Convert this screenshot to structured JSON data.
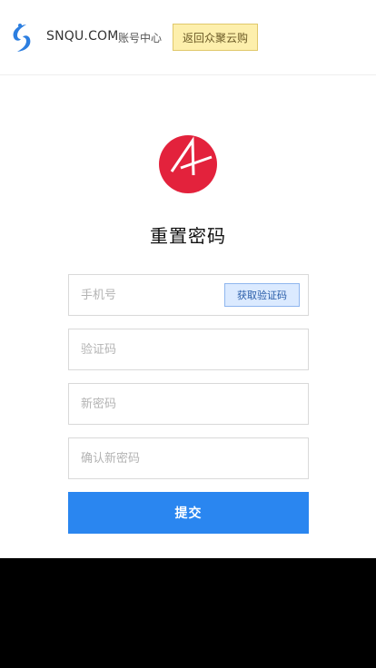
{
  "header": {
    "brand": "SNQU.COM",
    "subbrand": "账号中心",
    "back_label": "返回众聚云购",
    "logo_icon": "snqu-swirl-logo-icon",
    "colors": {
      "logo": "#2c7ee0",
      "back_bg": "#fdefac"
    }
  },
  "main": {
    "logo_icon": "app-red-circle-logo-icon",
    "title": "重置密码",
    "phone_placeholder": "手机号",
    "get_code_label": "获取验证码",
    "code_placeholder": "验证码",
    "new_password_placeholder": "新密码",
    "confirm_password_placeholder": "确认新密码",
    "submit_label": "提交",
    "colors": {
      "accent": "#2a86f0",
      "logo_red": "#e3223c"
    }
  }
}
